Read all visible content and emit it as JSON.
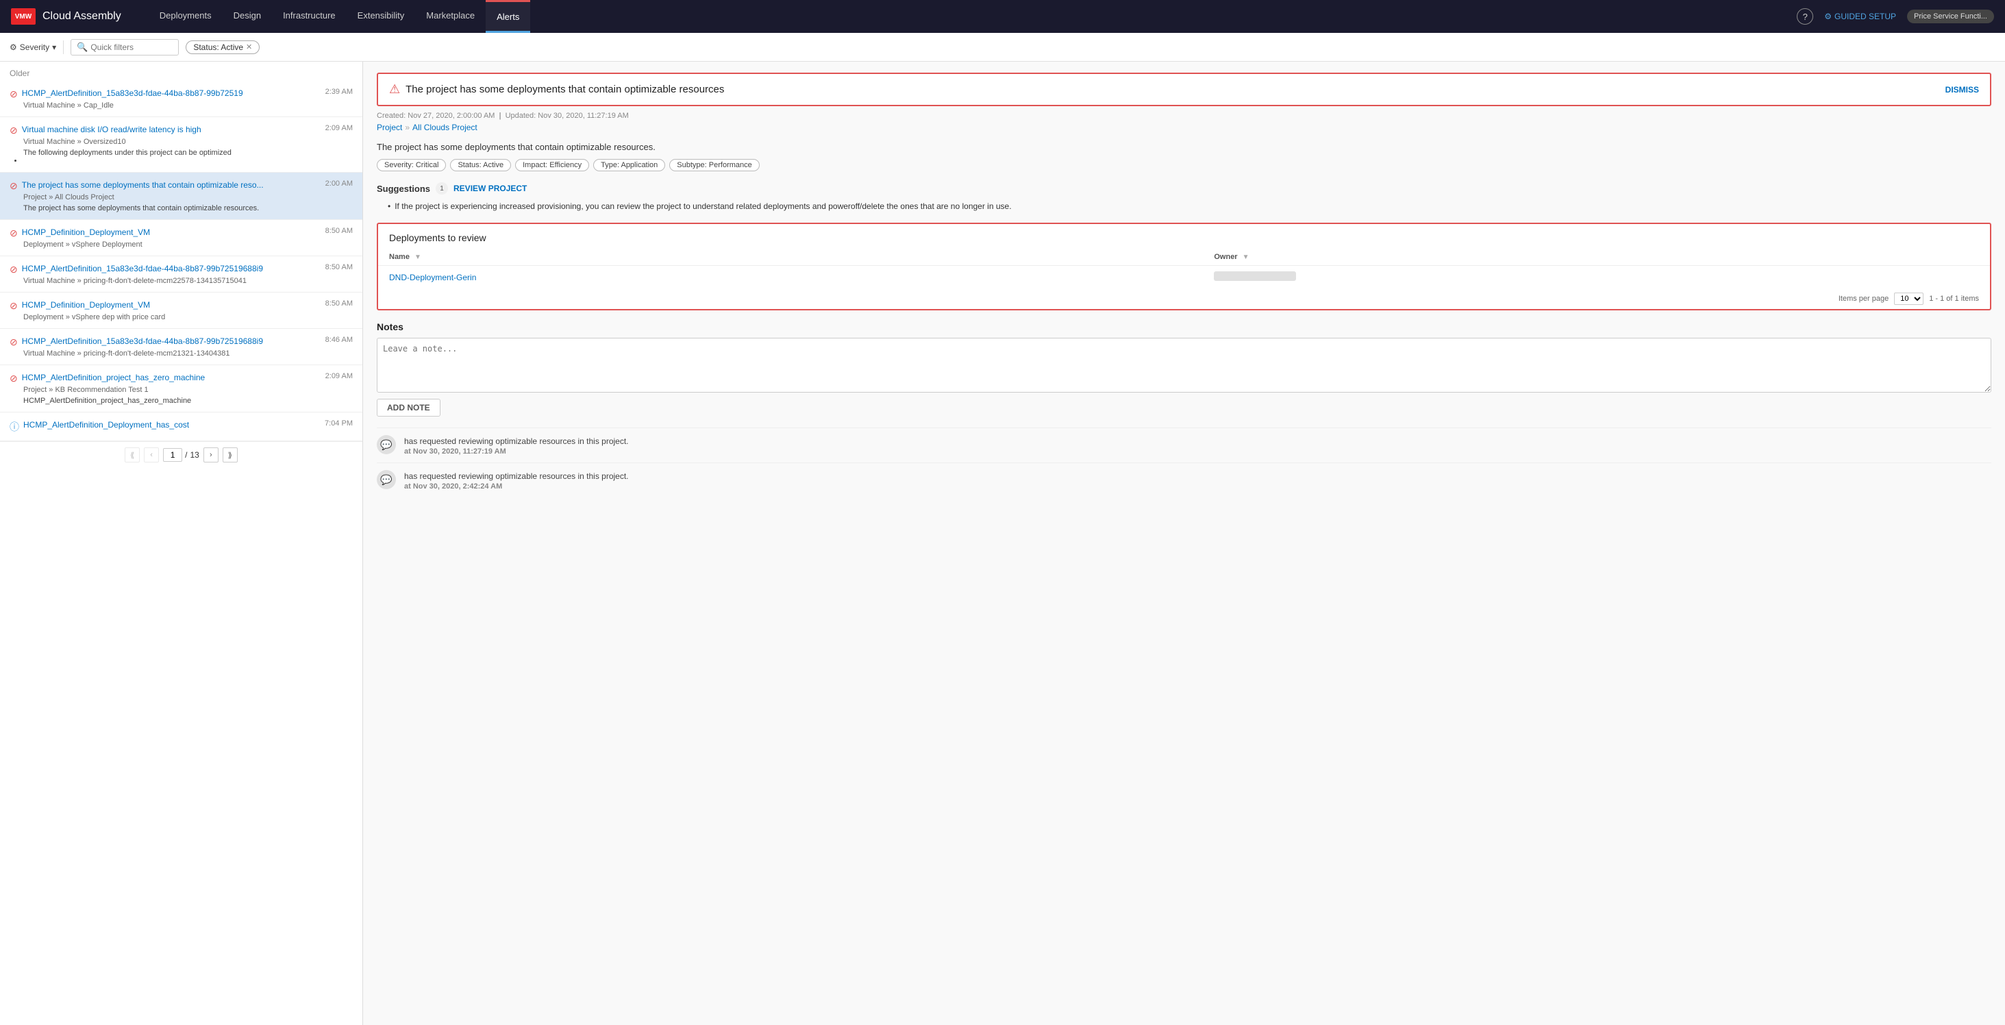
{
  "app": {
    "logo": "VMW",
    "title": "Cloud Assembly"
  },
  "nav": {
    "tabs": [
      {
        "id": "deployments",
        "label": "Deployments",
        "active": false
      },
      {
        "id": "design",
        "label": "Design",
        "active": false
      },
      {
        "id": "infrastructure",
        "label": "Infrastructure",
        "active": false
      },
      {
        "id": "extensibility",
        "label": "Extensibility",
        "active": false
      },
      {
        "id": "marketplace",
        "label": "Marketplace",
        "active": false
      },
      {
        "id": "alerts",
        "label": "Alerts",
        "active": true
      }
    ],
    "guided_setup": "GUIDED SETUP",
    "user": "Price Service Functi..."
  },
  "filter_bar": {
    "severity_label": "Severity",
    "quick_filters_placeholder": "Quick filters",
    "status_chip": "Status: Active"
  },
  "left_panel": {
    "section_label": "Older",
    "alerts": [
      {
        "id": 1,
        "icon": "error",
        "title": "HCMP_AlertDefinition_15a83e3d-fdae-44ba-8b87-99b72519",
        "time": "2:39 AM",
        "sub": "Virtual Machine  »  Cap_Idle",
        "desc": ""
      },
      {
        "id": 2,
        "icon": "error",
        "title": "Virtual machine disk I/O read/write latency is high",
        "time": "2:09 AM",
        "sub": "Virtual Machine  »  Oversized10",
        "desc": "The following deployments under this project can be optimized <ul> <li><a"
      },
      {
        "id": 3,
        "icon": "error",
        "title": "The project has some deployments that contain optimizable reso...",
        "time": "2:00 AM",
        "sub": "Project  »  All Clouds Project",
        "desc": "The project has some deployments that contain optimizable resources.",
        "selected": true
      },
      {
        "id": 4,
        "icon": "error",
        "title": "HCMP_Definition_Deployment_VM",
        "time": "8:50 AM",
        "sub": "Deployment  »  vSphere Deployment",
        "desc": ""
      },
      {
        "id": 5,
        "icon": "error",
        "title": "HCMP_AlertDefinition_15a83e3d-fdae-44ba-8b87-99b72519688i9",
        "time": "8:50 AM",
        "sub": "Virtual Machine  »  pricing-ft-don't-delete-mcm22578-134135715041",
        "desc": ""
      },
      {
        "id": 6,
        "icon": "error",
        "title": "HCMP_Definition_Deployment_VM",
        "time": "8:50 AM",
        "sub": "Deployment  »  vSphere dep with price card",
        "desc": ""
      },
      {
        "id": 7,
        "icon": "error",
        "title": "HCMP_AlertDefinition_15a83e3d-fdae-44ba-8b87-99b72519688i9",
        "time": "8:46 AM",
        "sub": "Virtual Machine  »  pricing-ft-don't-delete-mcm21321-13404381",
        "desc": ""
      },
      {
        "id": 8,
        "icon": "error",
        "title": "HCMP_AlertDefinition_project_has_zero_machine",
        "time": "2:09 AM",
        "sub": "Project  »  KB Recommendation Test 1",
        "desc": "HCMP_AlertDefinition_project_has_zero_machine"
      },
      {
        "id": 9,
        "icon": "info",
        "title": "HCMP_AlertDefinition_Deployment_has_cost",
        "time": "7:04 PM",
        "sub": "",
        "desc": ""
      }
    ],
    "pagination": {
      "current_page": "1",
      "total_pages": "13",
      "separator": "/"
    }
  },
  "right_panel": {
    "alert_title": "The project has some deployments that contain optimizable resources",
    "dismiss_label": "DISMISS",
    "meta": {
      "created": "Nov 27, 2020, 2:00:00 AM",
      "updated": "Nov 30, 2020, 11:27:19 AM",
      "created_label": "Created:",
      "updated_label": "Updated:"
    },
    "breadcrumb": {
      "parent": "Project",
      "child": "All Clouds Project"
    },
    "description": "The project has some deployments that contain optimizable resources.",
    "tags": [
      "Severity: Critical",
      "Status: Active",
      "Impact: Efficiency",
      "Type: Application",
      "Subtype: Performance"
    ],
    "suggestions": {
      "title": "Suggestions",
      "badge": "1",
      "review_label": "REVIEW PROJECT",
      "bullet": "If the project is experiencing increased provisioning, you can review the project to understand related deployments and poweroff/delete the ones that are no longer in use."
    },
    "deployments_section": {
      "title": "Deployments to review",
      "columns": [
        "Name",
        "Owner"
      ],
      "rows": [
        {
          "name": "DND-Deployment-Gerin",
          "owner": ""
        }
      ],
      "items_per_page_label": "Items per page",
      "items_per_page": "10",
      "count": "1 - 1 of 1 items"
    },
    "notes": {
      "title": "Notes",
      "placeholder": "Leave a note...",
      "add_button": "ADD NOTE"
    },
    "activity": [
      {
        "id": 1,
        "text": "has requested reviewing optimizable resources in this project.",
        "time": "at Nov 30, 2020, 11:27:19 AM"
      },
      {
        "id": 2,
        "text": "has requested reviewing optimizable resources in this project.",
        "time": "at Nov 30, 2020, 2:42:24 AM"
      }
    ]
  }
}
